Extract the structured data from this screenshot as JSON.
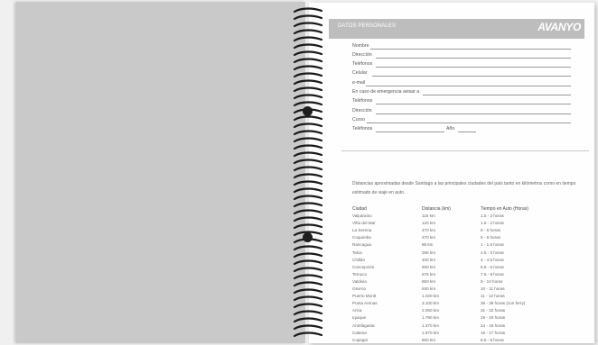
{
  "header": {
    "title": "DATOS PERSONALES",
    "brand": "AVANYO"
  },
  "fields": [
    {
      "label": "Nombre"
    },
    {
      "label": "Dirección"
    },
    {
      "label": "Teléfonos"
    },
    {
      "label": "Celular"
    },
    {
      "label": "e-mail"
    },
    {
      "label": "En caso de emergencia avisar a"
    },
    {
      "label": "Teléfonos"
    },
    {
      "label": "Dirección"
    },
    {
      "label": "Curso"
    },
    {
      "label": "Teléfonos",
      "extra_label": "Año"
    }
  ],
  "intro_text": "Distancias aproximadas desde Santiago a las principales ciudades del país tanto en kilómetros como en tiempo estimado de viaje en auto.",
  "table": {
    "headers": [
      "Ciudad",
      "Distancia (km)",
      "Tiempo en Auto (Horas)"
    ],
    "rows": [
      [
        "Valparaíso",
        "115 km",
        "1.5 - 2 horas"
      ],
      [
        "Viña del Mar",
        "120 km",
        "1.5 - 2 horas"
      ],
      [
        "La Serena",
        "470 km",
        "5 - 6 horas"
      ],
      [
        "Coquimbo",
        "470 km",
        "5 - 6 horas"
      ],
      [
        "Rancagua",
        "85 km",
        "1 - 1.5 horas"
      ],
      [
        "Talca",
        "255 km",
        "2.5 - 3 horas"
      ],
      [
        "Chillán",
        "400 km",
        "4 - 4.5 horas"
      ],
      [
        "Concepción",
        "500 km",
        "5.5 - 6 horas"
      ],
      [
        "Temuco",
        "675 km",
        "7.5 - 8 horas"
      ],
      [
        "Valdivia",
        "850 km",
        "9 - 10 horas"
      ],
      [
        "Osorno",
        "930 km",
        "10 - 11 horas"
      ],
      [
        "Puerto Montt",
        "1.020 km",
        "11 - 12 horas"
      ],
      [
        "Punta Arenas",
        "3.100 km",
        "36 - 38 horas (con ferry)"
      ],
      [
        "Arica",
        "2.050 km",
        "31 - 32 horas"
      ],
      [
        "Iquique",
        "1.790 km",
        "19 - 20 horas"
      ],
      [
        "Antofagasta",
        "1.370 km",
        "14 - 15 horas"
      ],
      [
        "Calama",
        "1.570 km",
        "16 - 17 horas"
      ],
      [
        "Copiapó",
        "800 km",
        "8.5 - 9 horas"
      ]
    ]
  },
  "colors": {
    "cover": "#c9c9c9",
    "header_bar": "#bdbdbd",
    "hole": "#1e1e1e"
  }
}
